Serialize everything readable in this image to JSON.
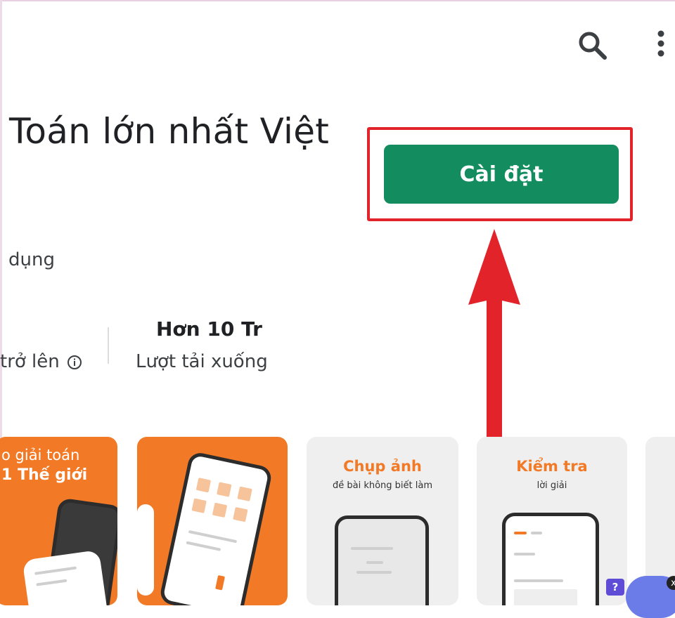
{
  "header": {
    "search_icon": "search-icon",
    "more_icon": "more-vert-icon"
  },
  "app": {
    "title": "Toán lớn nhất Việt",
    "subtitle": "dụng",
    "install_label": "Cài đặt"
  },
  "stats": {
    "age_label": "trở lên",
    "downloads_value": "Hơn 10 Tr",
    "downloads_label": "Lượt tải xuống"
  },
  "screenshots": [
    {
      "line1": "o giải toán",
      "line2": "1 Thế giới"
    },
    {
      "line1": ""
    },
    {
      "title": "Chụp ảnh",
      "subtitle": "đề bài không biết làm"
    },
    {
      "title": "Kiểm tra",
      "subtitle": "lời giải"
    }
  ],
  "overlay": {
    "help_badge": "?",
    "close_label": "x"
  },
  "colors": {
    "install_green": "#138d5f",
    "annotation_red": "#e3232a",
    "brand_orange": "#f27a26"
  }
}
